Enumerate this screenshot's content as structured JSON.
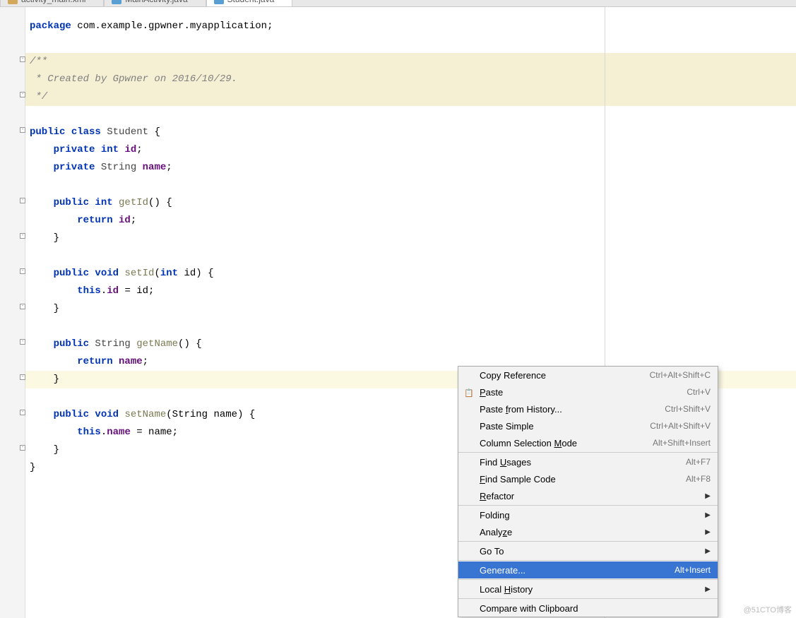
{
  "tabs": [
    {
      "label": "activity_main.xml",
      "type": "xml"
    },
    {
      "label": "MainActivity.java",
      "type": "java"
    },
    {
      "label": "Student.java",
      "type": "java",
      "active": true
    }
  ],
  "code": {
    "l1_pkg": "package ",
    "l1_path": "com.example.gpwner.myapplication",
    "l1_end": ";",
    "c1": "/**",
    "c2": " * Created by Gpwner on 2016/10/29.",
    "c3": " */",
    "cls_public": "public ",
    "cls_class": "class ",
    "cls_name": "Student ",
    "cls_open": "{",
    "f1_priv": "    private ",
    "f1_type": "int ",
    "f1_name": "id",
    "f1_end": ";",
    "f2_priv": "    private ",
    "f2_type": "String ",
    "f2_name": "name",
    "f2_end": ";",
    "m1_pub": "    public ",
    "m1_ret": "int ",
    "m1_name": "getId",
    "m1_sig": "() {",
    "m1_ret_kw": "        return ",
    "m1_ret_val": "id",
    "m1_ret_end": ";",
    "m1_close": "    }",
    "m2_pub": "    public ",
    "m2_void": "void ",
    "m2_name": "setId",
    "m2_open": "(",
    "m2_ptype": "int ",
    "m2_pname": "id",
    "m2_sig": ") {",
    "m2_this": "        this",
    "m2_dot": ".",
    "m2_field": "id",
    "m2_eq": " = id;",
    "m2_close": "    }",
    "m3_pub": "    public ",
    "m3_ret": "String ",
    "m3_name": "getName",
    "m3_sig": "() {",
    "m3_ret_kw": "        return ",
    "m3_ret_val": "name",
    "m3_ret_end": ";",
    "m3_close": "    }",
    "m4_pub": "    public ",
    "m4_void": "void ",
    "m4_name": "setName",
    "m4_open": "(String ",
    "m4_pname": "name",
    "m4_sig": ") {",
    "m4_this": "        this",
    "m4_dot": ".",
    "m4_field": "name",
    "m4_eq": " = name;",
    "m4_close": "    }",
    "cls_close": "}"
  },
  "menu": {
    "copyReference": {
      "label": "Copy Reference",
      "shortcut": "Ctrl+Alt+Shift+C"
    },
    "paste": {
      "pre": "",
      "u": "P",
      "post": "aste",
      "shortcut": "Ctrl+V"
    },
    "pasteHistory": {
      "pre": "Paste ",
      "u": "f",
      "post": "rom History...",
      "shortcut": "Ctrl+Shift+V"
    },
    "pasteSimple": {
      "label": "Paste Simple",
      "shortcut": "Ctrl+Alt+Shift+V"
    },
    "columnMode": {
      "pre": "Column Selection ",
      "u": "M",
      "post": "ode",
      "shortcut": "Alt+Shift+Insert"
    },
    "findUsages": {
      "pre": "Find ",
      "u": "U",
      "post": "sages",
      "shortcut": "Alt+F7"
    },
    "findSample": {
      "pre": "",
      "u": "F",
      "post": "ind Sample Code",
      "shortcut": "Alt+F8"
    },
    "refactor": {
      "pre": "",
      "u": "R",
      "post": "efactor"
    },
    "folding": {
      "label": "Folding"
    },
    "analyze": {
      "pre": "Analy",
      "u": "z",
      "post": "e"
    },
    "goto": {
      "label": "Go To"
    },
    "generate": {
      "label": "Generate...",
      "shortcut": "Alt+Insert"
    },
    "localHistory": {
      "pre": "Local ",
      "u": "H",
      "post": "istory"
    },
    "compareClipboard": {
      "label": "Compare with Clipboard"
    }
  },
  "watermark": "@51CTO博客"
}
